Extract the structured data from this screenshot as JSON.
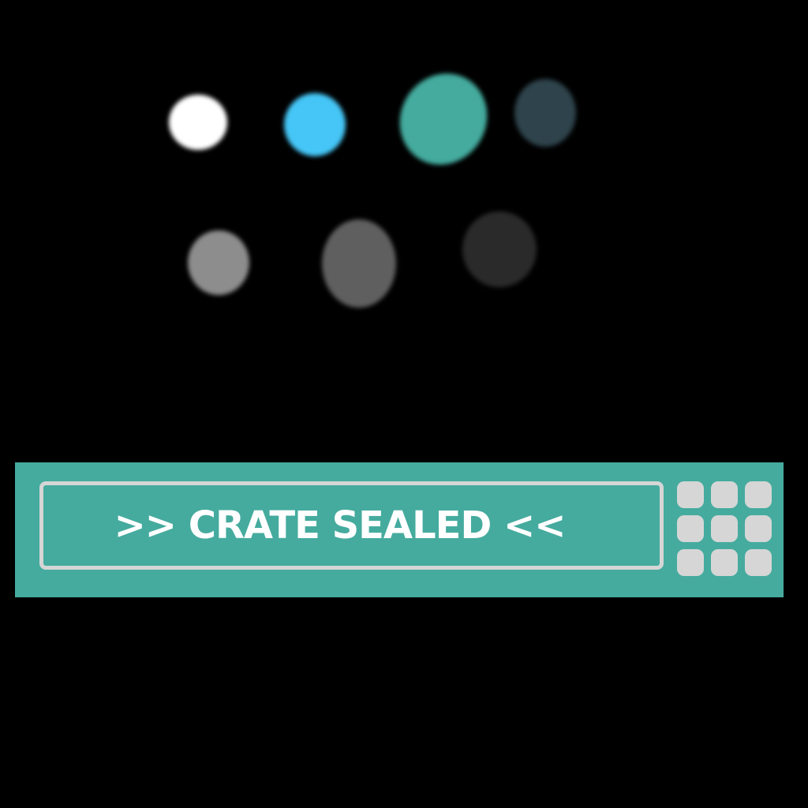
{
  "status": {
    "message": ">> CRATE SEALED <<"
  },
  "colors": {
    "background": "#000000",
    "bar": "#45ab9e",
    "panel_border": "#d6d6d6",
    "text": "#ffffff",
    "key": "#d6d6d6"
  },
  "lights": [
    {
      "name": "light-white",
      "color": "#ffffff"
    },
    {
      "name": "light-cyan",
      "color": "#45c6f6"
    },
    {
      "name": "light-teal",
      "color": "#44ab9e"
    },
    {
      "name": "light-dark-slate",
      "color": "#2e434b"
    },
    {
      "name": "light-gray",
      "color": "#8d8d8d"
    },
    {
      "name": "light-dim-gray",
      "color": "#5f5f5f"
    },
    {
      "name": "light-charcoal",
      "color": "#2a2a2a"
    }
  ],
  "keypad": {
    "rows": 3,
    "columns": 3
  }
}
